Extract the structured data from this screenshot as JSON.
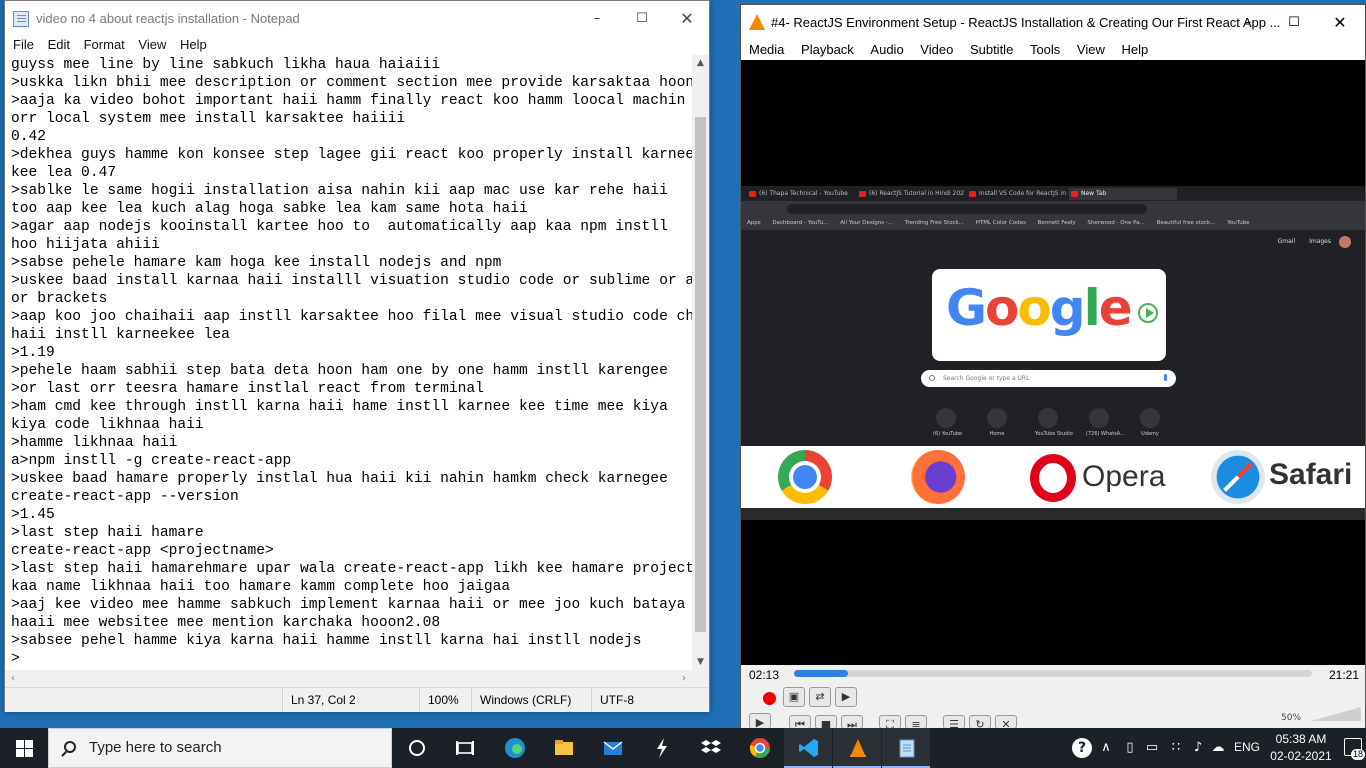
{
  "notepad": {
    "title": "video no 4 about reactjs installation - Notepad",
    "menu": [
      "File",
      "Edit",
      "Format",
      "View",
      "Help"
    ],
    "content": "guyss mee line by line sabkuch likha haua haiaiii\n>uskka likn bhii mee description or comment section mee provide karsaktaa hoon\n>aaja ka video bohot important haii hamm finally react koo hamm loocal machin\norr local system mee install karsaktee haiiii\n0.42\n>dekhea guys hamme kon konsee step lagee gii react koo properly install karnee\nkee lea 0.47\n>sablke le same hogii installation aisa nahin kii aap mac use kar rehe haii\ntoo aap kee lea kuch alag hoga sabke lea kam same hota haii\n>agar aap nodejs kooinstall kartee hoo to  automatically aap kaa npm instll\nhoo hiijata ahiii\n>sabse pehele hamare kam hoga kee install nodejs and npm\n>uskee baad install karnaa haii installl visuation studio code or sublime or atom\nor brackets\n>aap koo joo chaihaii aap instll karsaktee hoo filal mee visual studio code chuna\nhaii instll karneekee lea\n>1.19\n>pehele haam sabhii step bata deta hoon ham one by one hamm instll karengee\n>or last orr teesra hamare instlal react from terminal\n>ham cmd kee through instll karna haii hame instll karnee kee time mee kiya\nkiya code likhnaa haii\n>hamme likhnaa haii\na>npm instll -g create-react-app\n>uskee baad hamare properly instlal hua haii kii nahin hamkm check karnegee\ncreate-react-app --version\n>1.45\n>last step haii hamare\ncreate-react-app <projectname>\n>last step haii hamarehmare upar wala create-react-app likh kee hamare project\nkaa name likhnaa haii too hamare kamm complete hoo jaigaa\n>aaj kee video mee hamme sabkuch implement karnaa haii or mee joo kuch bataya\nhaaii mee websitee mee mention karchaka hooon2.08\n>sabsee pehel hamme kiya karna haii hamme instll karna hai instll nodejs\n>",
    "status": {
      "position": "Ln 37, Col 2",
      "zoom": "100%",
      "line_ending": "Windows (CRLF)",
      "encoding": "UTF-8"
    }
  },
  "vlc": {
    "title": "#4- ReactJS Environment Setup - ReactJS Installation & Creating Our First React App ...",
    "menu": [
      "Media",
      "Playback",
      "Audio",
      "Video",
      "Subtitle",
      "Tools",
      "View",
      "Help"
    ],
    "elapsed": "02:13",
    "duration": "21:21",
    "progress": 0.104,
    "volume": "50%",
    "video": {
      "tabs": [
        "(6) Thapa Technical - YouTube",
        "(6) ReactJS Tutorial in Hindi 2021",
        "Install VS Code for ReactJS in 20",
        "New Tab"
      ],
      "bookmarks": [
        "Apps",
        "Dashboard - YouTu...",
        "All Your Designs -...",
        "Trending Free Stock...",
        "HTML Color Codes",
        "Bennett Feely",
        "Sherwood - One Pa...",
        "Beautiful free stock...",
        "YouTube"
      ],
      "google_links": [
        "Gmail",
        "Images"
      ],
      "logo_text": "Google",
      "search_placeholder": "Search Google or type a URL",
      "shortcuts": [
        "(6) YouTube",
        "Home",
        "YouTube Studio",
        "(726) WhatsA...",
        "Udemy"
      ],
      "banner": {
        "opera": "Opera",
        "safari": "Safari"
      }
    }
  },
  "taskbar": {
    "search_placeholder": "Type here to search",
    "language": "ENG",
    "time": "05:38 AM",
    "date": "02-02-2021",
    "notifications": "18"
  },
  "colors": {
    "seek_fill": "#2f7fe0",
    "vlc_orange": "#f08a00",
    "taskbar": "#1b2127"
  }
}
